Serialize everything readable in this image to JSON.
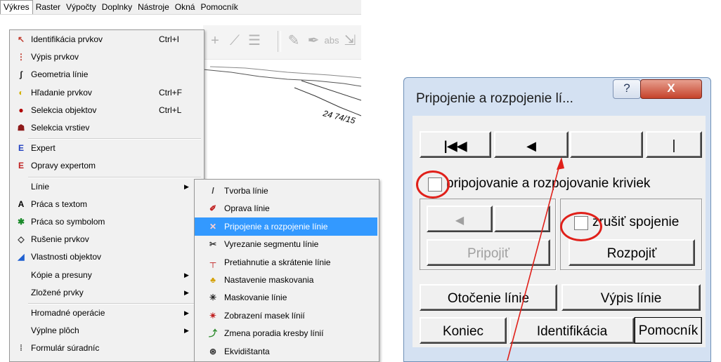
{
  "menubar": [
    "Výkres",
    "Raster",
    "Výpočty",
    "Doplnky",
    "Nástroje",
    "Okná",
    "Pomocník"
  ],
  "main_menu": [
    {
      "icon": "pointer-icon",
      "label": "Identifikácia prvkov",
      "shortcut": "Ctrl+I"
    },
    {
      "icon": "list-icon",
      "label": "Výpis prvkov",
      "shortcut": ""
    },
    {
      "icon": "line-geometry-icon",
      "label": "Geometria línie",
      "shortcut": ""
    },
    {
      "icon": "search-element-icon",
      "label": "Hľadanie prvkov",
      "shortcut": "Ctrl+F"
    },
    {
      "icon": "select-objects-icon",
      "label": "Selekcia objektov",
      "shortcut": "Ctrl+L"
    },
    {
      "icon": "select-layers-icon",
      "label": "Selekcia vrstiev",
      "shortcut": ""
    },
    {
      "icon": "expert-icon",
      "label": "Expert",
      "shortcut": ""
    },
    {
      "icon": "expert-repair-icon",
      "label": "Opravy expertom",
      "shortcut": ""
    },
    {
      "icon": "",
      "label": "Línie",
      "shortcut": "",
      "arrow": true
    },
    {
      "icon": "text-icon",
      "label": "Práca s textom",
      "shortcut": ""
    },
    {
      "icon": "symbol-icon",
      "label": "Práca so symbolom",
      "shortcut": ""
    },
    {
      "icon": "eraser-icon",
      "label": "Rušenie prvkov",
      "shortcut": ""
    },
    {
      "icon": "object-properties-icon",
      "label": "Vlastnosti objektov",
      "shortcut": ""
    },
    {
      "icon": "",
      "label": "Kópie a presuny",
      "shortcut": "",
      "arrow": true
    },
    {
      "icon": "",
      "label": "Zložené prvky",
      "shortcut": "",
      "arrow": true
    },
    {
      "icon": "",
      "label": "Hromadné operácie",
      "shortcut": "",
      "arrow": true
    },
    {
      "icon": "",
      "label": "Výplne plôch",
      "shortcut": "",
      "arrow": true
    },
    {
      "icon": "coordinates-form-icon",
      "label": "Formulár súradníc",
      "shortcut": ""
    }
  ],
  "sub_menu": [
    {
      "icon": "create-line-icon",
      "label": "Tvorba línie"
    },
    {
      "icon": "repair-line-icon",
      "label": "Oprava línie"
    },
    {
      "icon": "connect-line-icon",
      "label": "Pripojenie a rozpojenie línie",
      "highlighted": true
    },
    {
      "icon": "cut-segment-icon",
      "label": "Vyrezanie segmentu línie"
    },
    {
      "icon": "extend-trim-icon",
      "label": "Pretiahnutie a skrátenie línie"
    },
    {
      "icon": "mask-settings-icon",
      "label": "Nastavenie maskovania"
    },
    {
      "icon": "mask-line-icon",
      "label": "Maskovanie línie"
    },
    {
      "icon": "show-masks-icon",
      "label": "Zobrazení masek línií"
    },
    {
      "icon": "draw-order-icon",
      "label": "Zmena poradia kresby línií"
    },
    {
      "icon": "equidistant-icon",
      "label": "Ekvidištanta"
    }
  ],
  "drawing": {
    "label": "24 74/15"
  },
  "dialog": {
    "title": "Pripojenie a rozpojenie lí...",
    "help_glyph": "?",
    "close_glyph": "X",
    "nav_buttons": [
      "|◀◀",
      "◀",
      "",
      "|"
    ],
    "connect_checkbox_label": "pripojovanie a rozpojovanie kriviek",
    "small_nav": [
      "◀",
      ""
    ],
    "cancel_checkbox_label": "zrušiť spojenie",
    "attach_label": "Pripojiť",
    "detach_label": "Rozpojiť",
    "rotate_label": "Otočenie línie",
    "listing_label": "Výpis línie",
    "end_label": "Koniec",
    "identify_label": "Identifikácia",
    "help_label": "Pomocník"
  },
  "colors": {
    "highlight": "#3399ff",
    "annotation": "#e0201a",
    "dialog_frame": "#d4e1f2"
  }
}
